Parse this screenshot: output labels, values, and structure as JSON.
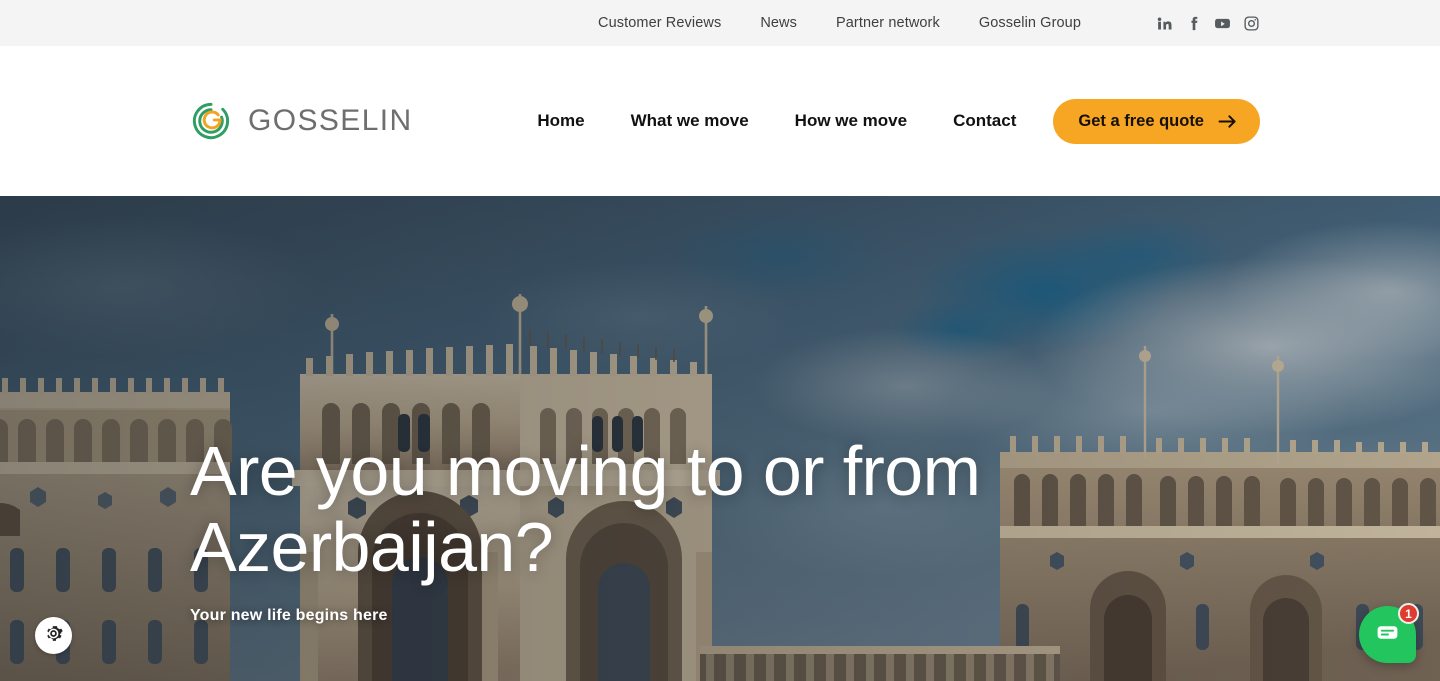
{
  "topbar": {
    "links": [
      {
        "label": "Customer Reviews"
      },
      {
        "label": "News"
      },
      {
        "label": "Partner network"
      },
      {
        "label": "Gosselin Group"
      }
    ],
    "social": [
      {
        "name": "linkedin-icon",
        "label": "LinkedIn"
      },
      {
        "name": "facebook-icon",
        "label": "Facebook"
      },
      {
        "name": "youtube-icon",
        "label": "YouTube"
      },
      {
        "name": "instagram-icon",
        "label": "Instagram"
      }
    ],
    "background_color": "#f3f4f3"
  },
  "header": {
    "brand_name": "GOSSELIN",
    "logo_icon": "gosselin-spiral-logo",
    "logo_colors": {
      "ring": "#2e9e63",
      "inner": "#f0a41f"
    },
    "nav": [
      {
        "label": "Home"
      },
      {
        "label": "What we move"
      },
      {
        "label": "How we move"
      },
      {
        "label": "Contact"
      }
    ],
    "cta": {
      "label": "Get a free quote",
      "icon": "arrow-right-icon",
      "background_color": "#f6a623",
      "text_color": "#15100a"
    }
  },
  "hero": {
    "title": "Are you moving to or from Azerbaijan?",
    "subtitle": "Your new life begins here",
    "image_alt": "Government House of Baku, Azerbaijan at dusk",
    "text_color": "#ffffff"
  },
  "widgets": {
    "cookie_settings": {
      "icon": "gear-icon",
      "label": "Cookie settings",
      "background_color": "#ffffff"
    },
    "chat": {
      "icon": "chat-message-icon",
      "label": "Chat",
      "badge_count": "1",
      "background_color": "#22c55e",
      "badge_color": "#e03b2f"
    }
  }
}
